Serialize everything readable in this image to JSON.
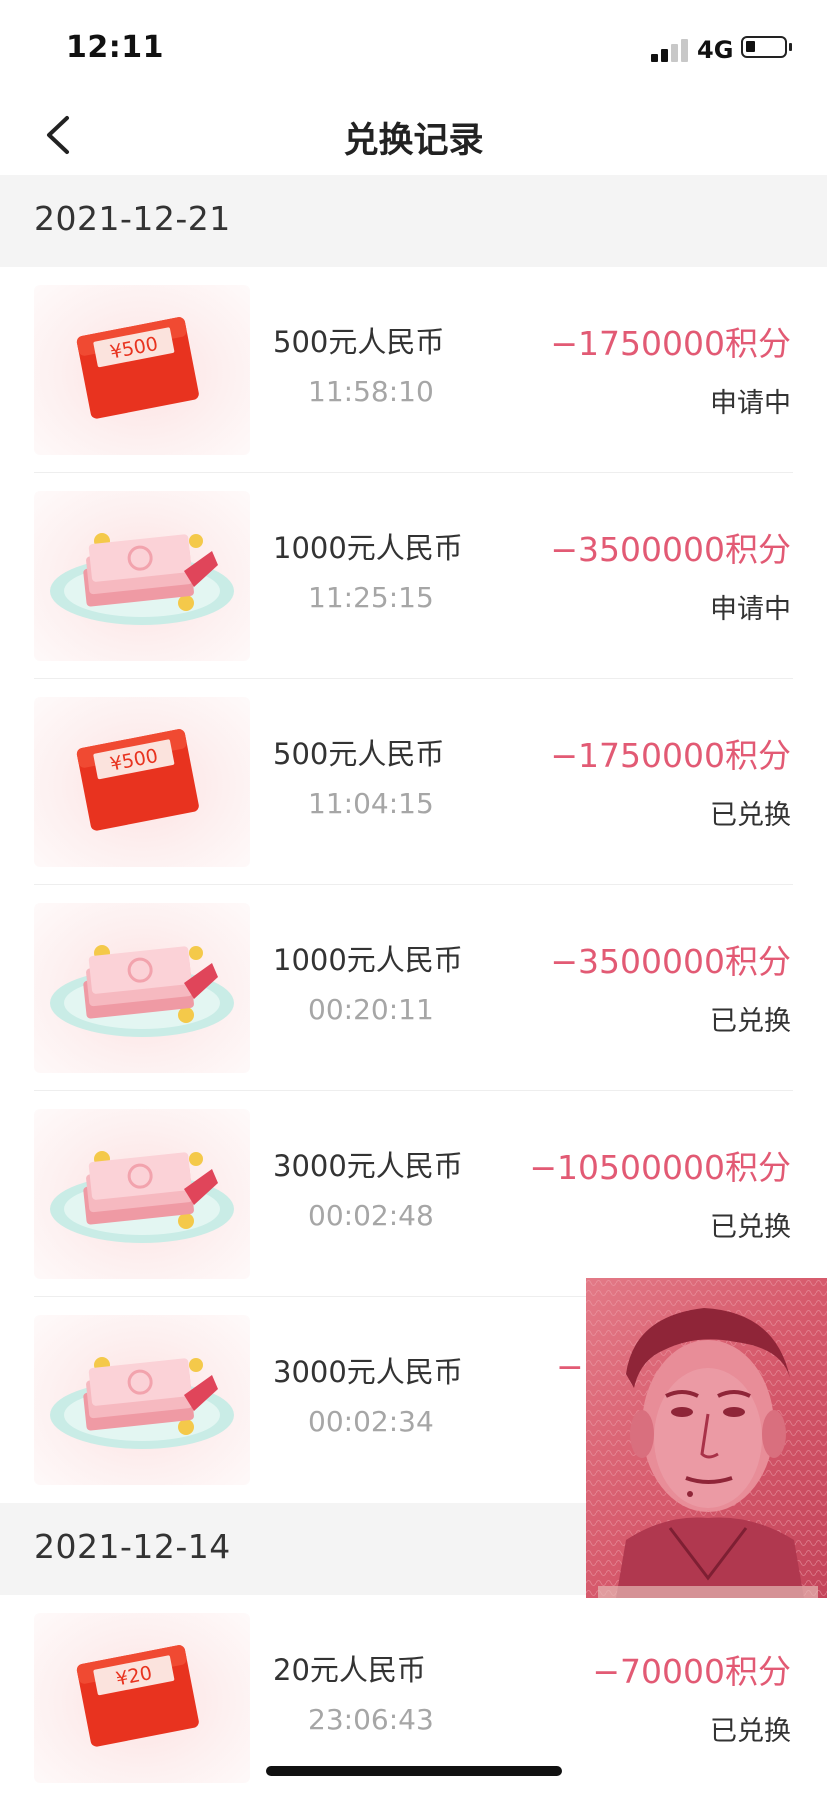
{
  "status_bar": {
    "time": "12:11",
    "network": "4G"
  },
  "nav": {
    "title": "兑换记录",
    "back_icon": "chevron-left-icon"
  },
  "groups": [
    {
      "date": "2021-12-21",
      "items": [
        {
          "name": "500元人民币",
          "time": "11:58:10",
          "points": "−1750000积分",
          "status": "申请中",
          "icon": "red-packet-icon",
          "amount_label": "¥500"
        },
        {
          "name": "1000元人民币",
          "time": "11:25:15",
          "points": "−3500000积分",
          "status": "申请中",
          "icon": "cash-stack-icon"
        },
        {
          "name": "500元人民币",
          "time": "11:04:15",
          "points": "−1750000积分",
          "status": "已兑换",
          "icon": "red-packet-icon",
          "amount_label": "¥500"
        },
        {
          "name": "1000元人民币",
          "time": "00:20:11",
          "points": "−3500000积分",
          "status": "已兑换",
          "icon": "cash-stack-icon"
        },
        {
          "name": "3000元人民币",
          "time": "00:02:48",
          "points": "−10500000积分",
          "status": "已兑换",
          "icon": "cash-stack-icon"
        },
        {
          "name": "3000元人民币",
          "time": "00:02:34",
          "points": "−1",
          "status": "",
          "icon": "cash-stack-icon"
        }
      ]
    },
    {
      "date": "2021-12-14",
      "items": [
        {
          "name": "20元人民币",
          "time": "23:06:43",
          "points": "−70000积分",
          "status": "已兑换",
          "icon": "red-packet-icon",
          "amount_label": "¥20"
        }
      ]
    }
  ],
  "overlay": {
    "type": "banknote-photo"
  },
  "colors": {
    "points": "#e25a74",
    "header_bg": "#f4f4f4",
    "packet_red": "#e8331f",
    "note_pink": "#c9455a"
  }
}
